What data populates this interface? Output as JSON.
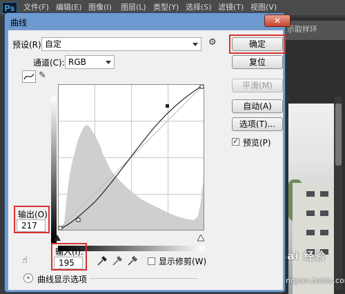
{
  "app": {
    "logo": "Ps",
    "menus": [
      "文件(F)",
      "编辑(E)",
      "图像(I)",
      "图层(L)",
      "类型(Y)",
      "选择(S)",
      "滤镜(T)",
      "视图(V)"
    ],
    "toolbar_hint": "示取样环"
  },
  "dialog": {
    "title": "曲线",
    "close": "✕",
    "preset_label": "预设(R):",
    "preset_value": "自定",
    "channel_label": "通道(C):",
    "channel_value": "RGB",
    "output_label": "输出(O):",
    "output_value": "217",
    "input_label": "输入(I):",
    "input_value": "195",
    "show_clipping_label": "显示修剪(W)",
    "show_clipping_checked": false,
    "curve_options_label": "曲线显示选项",
    "buttons": {
      "ok": "确定",
      "reset": "复位",
      "smooth": "平滑(M)",
      "auto": "自动(A)",
      "options": "选项(T)...",
      "preview": "预览(P)"
    },
    "preview_checked": true
  },
  "watermark": {
    "brand": "Bai 经验",
    "url": "jingyan.baidu.com"
  },
  "colors": {
    "highlight": "#d93030",
    "dialog_frame": "#6d9ad0"
  }
}
